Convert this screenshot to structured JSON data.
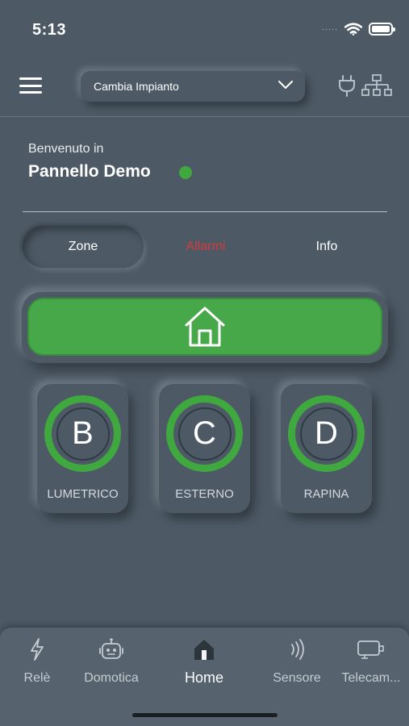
{
  "status_bar": {
    "time": "5:13",
    "signal": "·····"
  },
  "header": {
    "plant_select_value": "Cambia Impianto"
  },
  "welcome": {
    "greeting": "Benvenuto in",
    "panel_name": "Pannello Demo"
  },
  "tabs": [
    {
      "label": "Zone"
    },
    {
      "label": "Allarmi"
    },
    {
      "label": "Info"
    }
  ],
  "zones": [
    {
      "letter": "B",
      "name": "LUMETRICO"
    },
    {
      "letter": "C",
      "name": "ESTERNO"
    },
    {
      "letter": "D",
      "name": "RAPINA"
    }
  ],
  "bottom_nav": [
    {
      "label": "Relè",
      "icon": "lightning-icon"
    },
    {
      "label": "Domotica",
      "icon": "robot-icon"
    },
    {
      "label": "Home",
      "icon": "home-icon"
    },
    {
      "label": "Sensore",
      "icon": "sensor-wave-icon"
    },
    {
      "label": "Telecam...",
      "icon": "camera-icon"
    }
  ],
  "colors": {
    "background": "#4d5a66",
    "accent_green": "#46a848",
    "alarm_red": "#d63a3a"
  }
}
